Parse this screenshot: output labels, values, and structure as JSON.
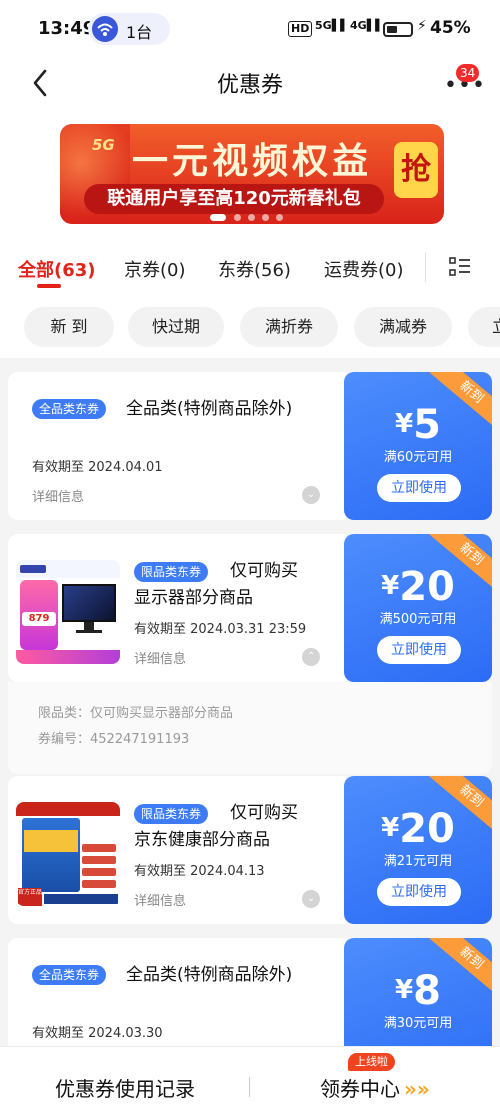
{
  "status_bar": {
    "time": "13:49",
    "pill_icon": "wifi-hotspot-icon",
    "pill_text": "1台",
    "hd": "HD",
    "signal_1": "5G",
    "signal_2": "4G",
    "battery_percent": "45%",
    "battery_level": 0.45
  },
  "header": {
    "title": "优惠券",
    "back_icon": "chevron-left-icon",
    "more_icon": "more-dots-icon",
    "more_badge": "34"
  },
  "banner": {
    "tag_5g": "5G",
    "title": "一元视频权益",
    "subtitle": "联通用户享至高120元新春礼包",
    "grab": "抢",
    "accent": "#e2231a"
  },
  "tabs": [
    {
      "label": "全部(63)",
      "active": true
    },
    {
      "label": "京券(0)",
      "active": false
    },
    {
      "label": "东券(56)",
      "active": false
    },
    {
      "label": "运费券(0)",
      "active": false
    }
  ],
  "list_view_icon": "list-view-icon",
  "chips": [
    "新 到",
    "快过期",
    "满折券",
    "满减券",
    "立"
  ],
  "coupons": [
    {
      "tag": "全品类东券",
      "title": "全品类(特例商品除外)",
      "expiry": "有效期至 2024.04.01",
      "detail": "详细信息",
      "ribbon": "新到",
      "currency": "¥",
      "amount": "5",
      "condition": "满60元可用",
      "button": "立即使用"
    },
    {
      "tag": "限品类东券",
      "title_line1": "仅可购买",
      "title_line2": "显示器部分商品",
      "expiry": "有效期至 2024.03.31 23:59",
      "detail": "详细信息",
      "ribbon": "新到",
      "currency": "¥",
      "amount": "20",
      "condition": "满500元可用",
      "button": "立即使用",
      "thumb_price": "879",
      "thumb_promo": "新品抢先",
      "expanded": {
        "limit": "限品类：仅可购买显示器部分商品",
        "code": "券编号：452247191193"
      }
    },
    {
      "tag": "限品类东券",
      "title_line1": "仅可购买",
      "title_line2": "京东健康部分商品",
      "expiry": "有效期至 2024.04.13",
      "detail": "详细信息",
      "ribbon": "新到",
      "currency": "¥",
      "amount": "20",
      "condition": "满21元可用",
      "button": "立即使用",
      "thumb_badge": "官方正品",
      "thumb_brand": "南京同仁堂"
    },
    {
      "tag": "全品类东券",
      "title": "全品类(特例商品除外)",
      "expiry": "有效期至 2024.03.30",
      "ribbon": "新到",
      "currency": "¥",
      "amount": "8",
      "condition": "满30元可用"
    }
  ],
  "bottom_bar": {
    "left": "优惠券使用记录",
    "right": "领券中心",
    "arrows": "»»",
    "badge": "上线啦"
  },
  "colors": {
    "accent_red": "#e2231a",
    "coupon_blue": "#2c6cf5",
    "ribbon_orange": "#fb9b3a",
    "tag_blue": "#3d7cf6"
  }
}
